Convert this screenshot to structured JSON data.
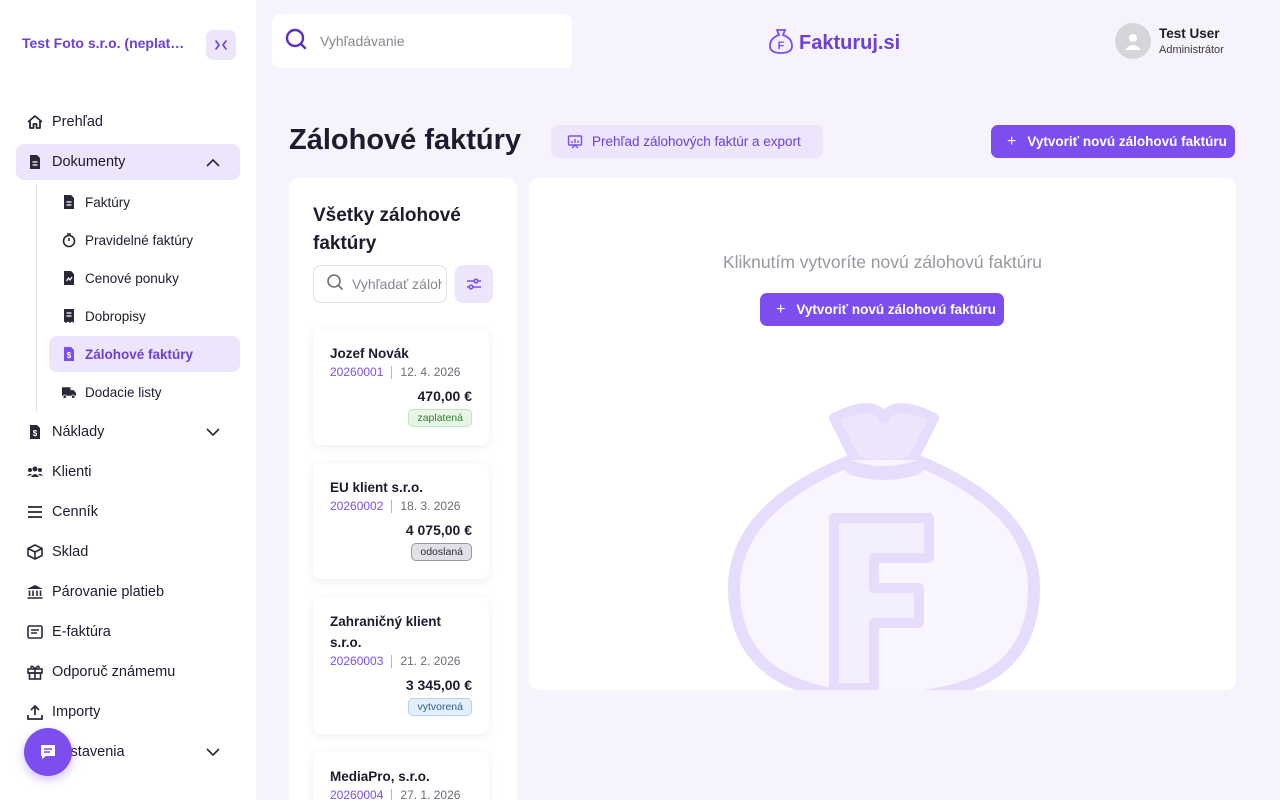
{
  "sidebar": {
    "company": "Test Foto s.r.o. (neplat…",
    "items": [
      {
        "label": "Prehľad"
      },
      {
        "label": "Dokumenty"
      },
      {
        "label": "Náklady"
      },
      {
        "label": "Klienti"
      },
      {
        "label": "Cenník"
      },
      {
        "label": "Sklad"
      },
      {
        "label": "Párovanie platieb"
      },
      {
        "label": "E-faktúra"
      },
      {
        "label": "Odporuč známemu"
      },
      {
        "label": "Importy"
      },
      {
        "label": "Nastavenia"
      }
    ],
    "sub_items": [
      {
        "label": "Faktúry"
      },
      {
        "label": "Pravidelné faktúry"
      },
      {
        "label": "Cenové ponuky"
      },
      {
        "label": "Dobropisy"
      },
      {
        "label": "Zálohové faktúry"
      },
      {
        "label": "Dodacie listy"
      }
    ]
  },
  "topbar": {
    "search_placeholder": "Vyhľadávanie",
    "logo": "Fakturuj.si",
    "user_name": "Test User",
    "user_role": "Administrátor"
  },
  "header": {
    "title": "Zálohové faktúry",
    "export_label": "Prehľad zálohových faktúr a export",
    "create_label": "Vytvoriť novú zálohovú faktúru"
  },
  "list": {
    "title": "Všetky zálohové faktúry",
    "search_placeholder": "Vyhľadať zálohovú faktúru",
    "cards": [
      {
        "name": "Jozef Novák",
        "number": "20260001",
        "date": "12. 4. 2026",
        "amount": "470,00 €",
        "status": "zaplatená"
      },
      {
        "name": "EU klient s.r.o.",
        "number": "20260002",
        "date": "18. 3. 2026",
        "amount": "4 075,00 €",
        "status": "odoslaná"
      },
      {
        "name": "Zahraničný klient s.r.o.",
        "number": "20260003",
        "date": "21. 2. 2026",
        "amount": "3 345,00 €",
        "status": "vytvorená"
      },
      {
        "name": "MediaPro, s.r.o.",
        "number": "20260004",
        "date": "27. 1. 2026",
        "amount": "",
        "status": ""
      }
    ]
  },
  "empty": {
    "text": "Kliknutím vytvoríte novú zálohovú faktúru",
    "button_label": "Vytvoriť novú zálohovú faktúru"
  },
  "colors": {
    "accent": "#7c4ef0",
    "accent_light": "#ece5fb",
    "background": "#f6f3fc"
  }
}
